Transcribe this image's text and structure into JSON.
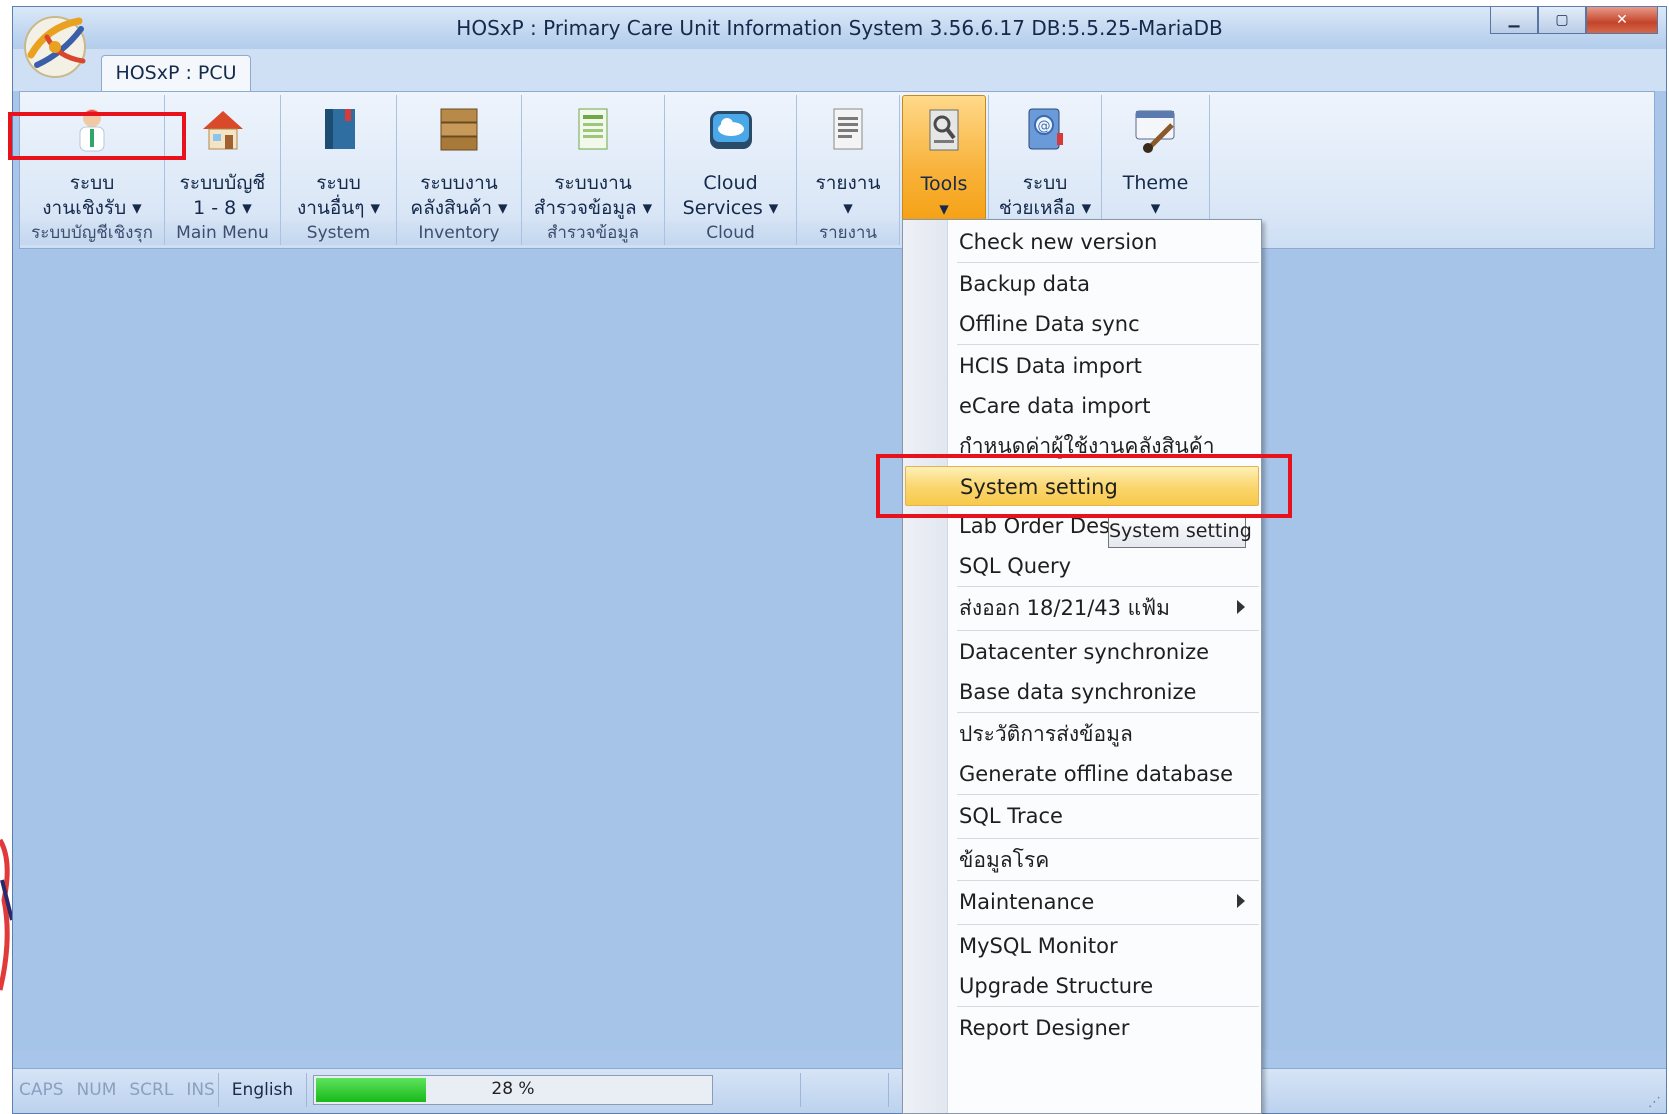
{
  "window": {
    "title": "HOSxP : Primary Care Unit Information System 3.56.6.17 DB:5.5.25-MariaDB"
  },
  "tab": {
    "label": "HOSxP : PCU"
  },
  "ribbon": {
    "groups": [
      {
        "label": "ระบบ\nงานเชิงรับ ▾",
        "caption": "ระบบบัญชีเชิงรุก",
        "icon": "doctor-icon"
      },
      {
        "label": "ระบบบัญชี\n1 - 8 ▾",
        "caption": "Main Menu",
        "icon": "house-icon"
      },
      {
        "label": "ระบบ\nงานอื่นๆ ▾",
        "caption": "System",
        "icon": "book-icon"
      },
      {
        "label": "ระบบงาน\nคลังสินค้า ▾",
        "caption": "Inventory",
        "icon": "boxes-icon"
      },
      {
        "label": "ระบบงาน\nสำรวจข้อมูล ▾",
        "caption": "สำรวจข้อมูล",
        "icon": "spreadsheet-icon"
      },
      {
        "label": "Cloud\nServices ▾",
        "caption": "Cloud",
        "icon": "cloud-icon"
      },
      {
        "label": "รายงาน\n▾",
        "caption": "รายงาน",
        "icon": "report-icon"
      },
      {
        "label": "Tools\n▾",
        "caption": "",
        "icon": "tools-icon"
      },
      {
        "label": "ระบบ\nช่วยเหลือ ▾",
        "caption": "",
        "icon": "help-book-icon"
      },
      {
        "label": "Theme\n▾",
        "caption": "",
        "icon": "theme-brush-icon"
      }
    ]
  },
  "menu": {
    "items": [
      "Check new version",
      "Backup data",
      "Offline Data sync",
      "HCIS Data import",
      "eCare data import",
      "กำหนดค่าผู้ใช้งานคลังสินค้า",
      "System setting",
      "Lab Order Design",
      "SQL Query",
      "ส่งออก 18/21/43 แฟ้ม",
      "Datacenter synchronize",
      "Base data synchronize",
      "ประวัติการส่งข้อมูล",
      "Generate offline database",
      "SQL Trace",
      "ข้อมูลโรค",
      "Maintenance",
      "MySQL Monitor",
      "Upgrade Structure",
      "Report Designer"
    ],
    "highlighted": "System setting"
  },
  "tooltip": {
    "text": "System setting"
  },
  "statusbar": {
    "caps": "CAPS",
    "num": "NUM",
    "scrl": "SCRL",
    "ins": "INS",
    "language": "English",
    "progress_text": "28 %",
    "progress_value": 0.28
  },
  "colors": {
    "highlight": "#f8c94a",
    "annotation_red": "#e8121c",
    "workspace": "#a6c3e8"
  }
}
